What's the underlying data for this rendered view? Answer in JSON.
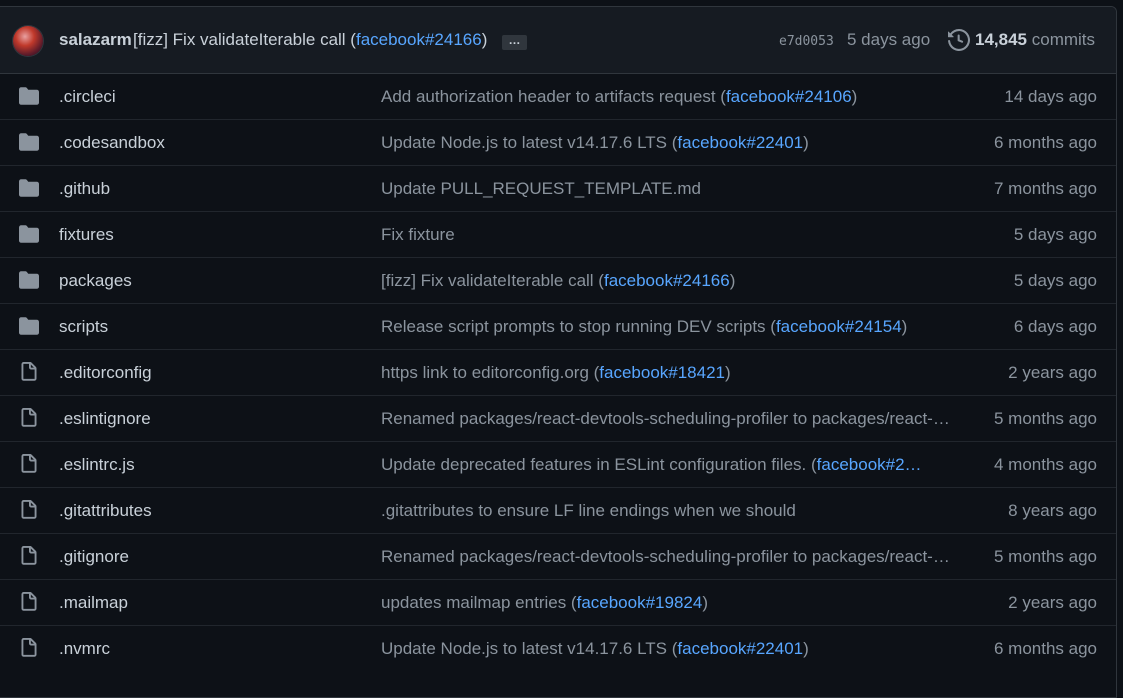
{
  "latest_commit": {
    "author": "salazarm",
    "message_prefix": "[fizz] Fix validateIterable call (",
    "message_link": "facebook#24166",
    "message_suffix": ")",
    "ellipsis": "…",
    "sha": "e7d0053",
    "time": "5 days ago",
    "commit_count": "14,845",
    "commit_word": "commits"
  },
  "files": [
    {
      "type": "folder",
      "name": ".circleci",
      "msg_pre": "Add authorization header to artifacts request (",
      "link": "facebook#24106",
      "msg_post": ")",
      "time": "14 days ago"
    },
    {
      "type": "folder",
      "name": ".codesandbox",
      "msg_pre": "Update Node.js to latest v14.17.6 LTS (",
      "link": "facebook#22401",
      "msg_post": ")",
      "time": "6 months ago"
    },
    {
      "type": "folder",
      "name": ".github",
      "msg_pre": "Update PULL_REQUEST_TEMPLATE.md",
      "link": "",
      "msg_post": "",
      "time": "7 months ago"
    },
    {
      "type": "folder",
      "name": "fixtures",
      "msg_pre": "Fix fixture",
      "link": "",
      "msg_post": "",
      "time": "5 days ago"
    },
    {
      "type": "folder",
      "name": "packages",
      "msg_pre": "[fizz] Fix validateIterable call (",
      "link": "facebook#24166",
      "msg_post": ")",
      "time": "5 days ago"
    },
    {
      "type": "folder",
      "name": "scripts",
      "msg_pre": "Release script prompts to stop running DEV scripts (",
      "link": "facebook#24154",
      "msg_post": ")",
      "time": "6 days ago"
    },
    {
      "type": "file",
      "name": ".editorconfig",
      "msg_pre": "https link to editorconfig.org (",
      "link": "facebook#18421",
      "msg_post": ")",
      "time": "2 years ago"
    },
    {
      "type": "file",
      "name": ".eslintignore",
      "msg_pre": "Renamed packages/react-devtools-scheduling-profiler to packages/react-devtools-timeline",
      "link": "",
      "msg_post": "",
      "time": "5 months ago"
    },
    {
      "type": "file",
      "name": ".eslintrc.js",
      "msg_pre": "Update deprecated features in ESLint configuration files. (",
      "link": "facebook#2…",
      "msg_post": "",
      "time": "4 months ago"
    },
    {
      "type": "file",
      "name": ".gitattributes",
      "msg_pre": ".gitattributes to ensure LF line endings when we should",
      "link": "",
      "msg_post": "",
      "time": "8 years ago"
    },
    {
      "type": "file",
      "name": ".gitignore",
      "msg_pre": "Renamed packages/react-devtools-scheduling-profiler to packages/react-devtools-timeline",
      "link": "",
      "msg_post": "",
      "time": "5 months ago"
    },
    {
      "type": "file",
      "name": ".mailmap",
      "msg_pre": "updates mailmap entries (",
      "link": "facebook#19824",
      "msg_post": ")",
      "time": "2 years ago"
    },
    {
      "type": "file",
      "name": ".nvmrc",
      "msg_pre": "Update Node.js to latest v14.17.6 LTS (",
      "link": "facebook#22401",
      "msg_post": ")",
      "time": "6 months ago"
    }
  ]
}
